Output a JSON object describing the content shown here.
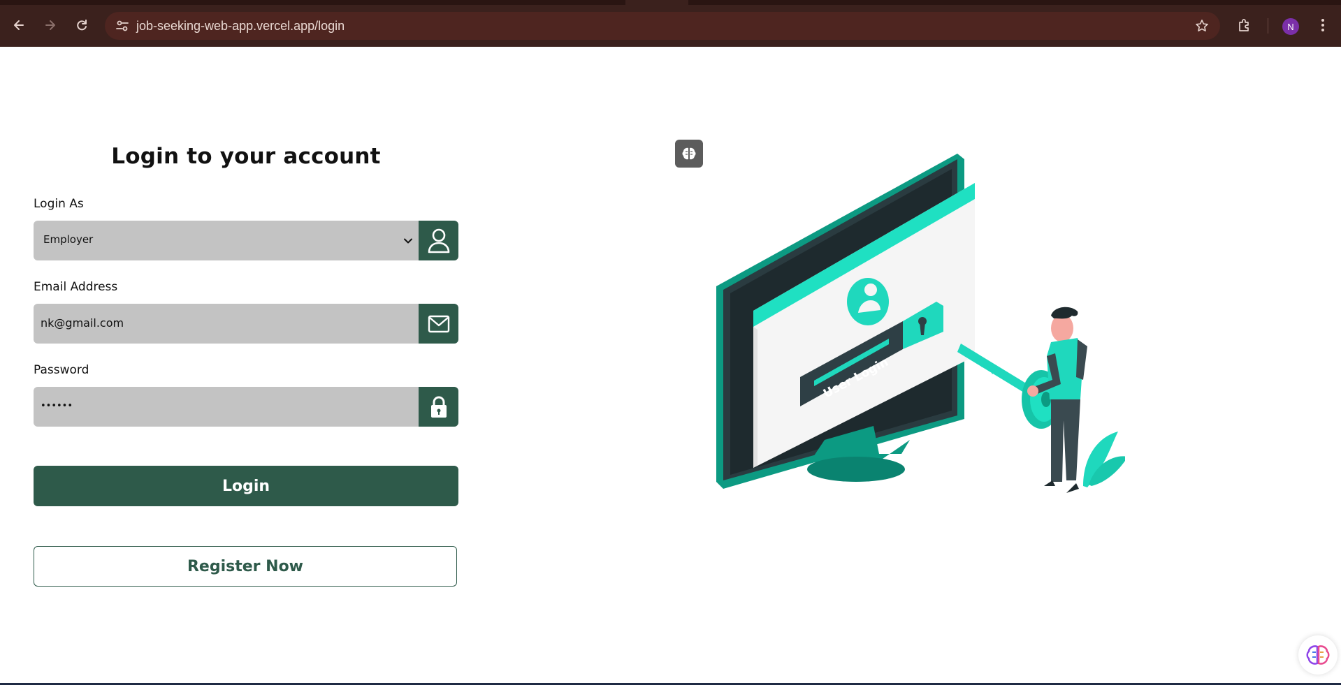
{
  "browser": {
    "url": "job-seeking-web-app.vercel.app/login",
    "profile_initial": "N",
    "icons": [
      "back-arrow-icon",
      "forward-arrow-icon",
      "reload-icon",
      "site-settings-icon",
      "bookmark-star-icon",
      "extensions-icon",
      "kebab-menu-icon"
    ]
  },
  "form": {
    "title": "Login to your account",
    "role": {
      "label": "Login As",
      "selected": "Employer",
      "icon": "user-icon"
    },
    "email": {
      "label": "Email Address",
      "value": "nk@gmail.com",
      "icon": "mail-icon"
    },
    "password": {
      "label": "Password",
      "value": "••••••",
      "icon": "lock-icon"
    },
    "login_label": "Login",
    "register_label": "Register Now"
  },
  "illustration": {
    "screen_text": "User Login"
  },
  "colors": {
    "primary": "#2e5a4a",
    "accent": "#1fd8bd",
    "field_bg": "#c3c3c3",
    "chrome_bg": "#3b211d"
  }
}
